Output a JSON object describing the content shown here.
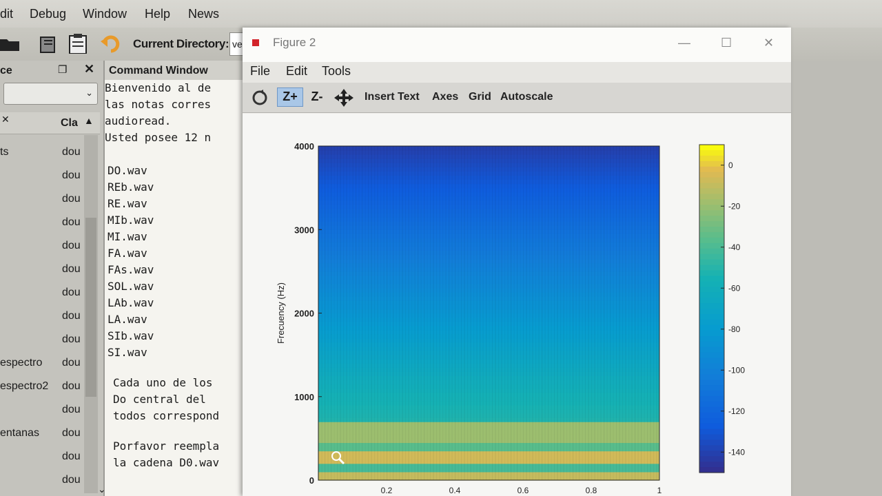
{
  "menubar": {
    "items": [
      "dit",
      "Debug",
      "Window",
      "Help",
      "News"
    ]
  },
  "toolbar": {
    "current_directory_label": "Current Directory:",
    "current_directory_value": "ve"
  },
  "workspace": {
    "title": "ce",
    "column_header": "Cla",
    "rows": [
      {
        "name": "ts",
        "class": "dou"
      },
      {
        "name": "",
        "class": "dou"
      },
      {
        "name": "",
        "class": "dou"
      },
      {
        "name": "",
        "class": "dou"
      },
      {
        "name": "",
        "class": "dou"
      },
      {
        "name": "",
        "class": "dou"
      },
      {
        "name": "",
        "class": "dou"
      },
      {
        "name": "",
        "class": "dou"
      },
      {
        "name": "",
        "class": "dou"
      },
      {
        "name": "espectro",
        "class": "dou"
      },
      {
        "name": "espectro2",
        "class": "dou"
      },
      {
        "name": "",
        "class": "dou"
      },
      {
        "name": "entanas",
        "class": "dou"
      },
      {
        "name": "",
        "class": "dou"
      },
      {
        "name": "",
        "class": "dou"
      }
    ]
  },
  "command_window": {
    "title": "Command Window",
    "lines": [
      "Bienvenido al de",
      "las notas corres",
      "audioread.",
      "Usted posee 12 n",
      "",
      "DO.wav",
      "REb.wav",
      "RE.wav",
      "MIb.wav",
      "MI.wav",
      "FA.wav",
      "FAs.wav",
      "SOL.wav",
      "LAb.wav",
      "LA.wav",
      "SIb.wav",
      "SI.wav",
      "",
      "Cada uno de los",
      "Do central  del",
      "todos correspond",
      "",
      "Porfavor reempla",
      "la cadena D0.wav"
    ]
  },
  "figure": {
    "title": "Figure 2",
    "menu": [
      "File",
      "Edit",
      "Tools"
    ],
    "toolbar": {
      "zoom_in": "Z+",
      "zoom_out": "Z-",
      "insert_text": "Insert Text",
      "axes": "Axes",
      "grid": "Grid",
      "autoscale": "Autoscale"
    }
  },
  "chart_data": {
    "type": "heatmap",
    "title": "",
    "xlabel": "",
    "ylabel": "Frecuency (Hz)",
    "xlim": [
      0,
      1
    ],
    "ylim": [
      0,
      4000
    ],
    "x_ticks": [
      "0.2",
      "0.4",
      "0.6",
      "0.8",
      "1"
    ],
    "y_ticks": [
      "0",
      "1000",
      "2000",
      "3000",
      "4000"
    ],
    "colorbar": {
      "ticks": [
        "0",
        "-20",
        "-40",
        "-60",
        "-80",
        "-100",
        "-120",
        "-140"
      ],
      "range": [
        -150,
        10
      ],
      "colormap": "parula"
    },
    "bands": [
      {
        "freq_low": 0,
        "freq_high": 100,
        "level_db": -8
      },
      {
        "freq_low": 100,
        "freq_high": 190,
        "level_db": -40
      },
      {
        "freq_low": 190,
        "freq_high": 340,
        "level_db": -5
      },
      {
        "freq_low": 340,
        "freq_high": 420,
        "level_db": -35
      },
      {
        "freq_low": 420,
        "freq_high": 700,
        "level_db": -18
      }
    ],
    "background_db_at_1000": -55,
    "background_db_at_4000": -140
  },
  "colors": {
    "fig_title_icon": "#d2232a",
    "zoom_in_active": "#a9c7e7"
  }
}
